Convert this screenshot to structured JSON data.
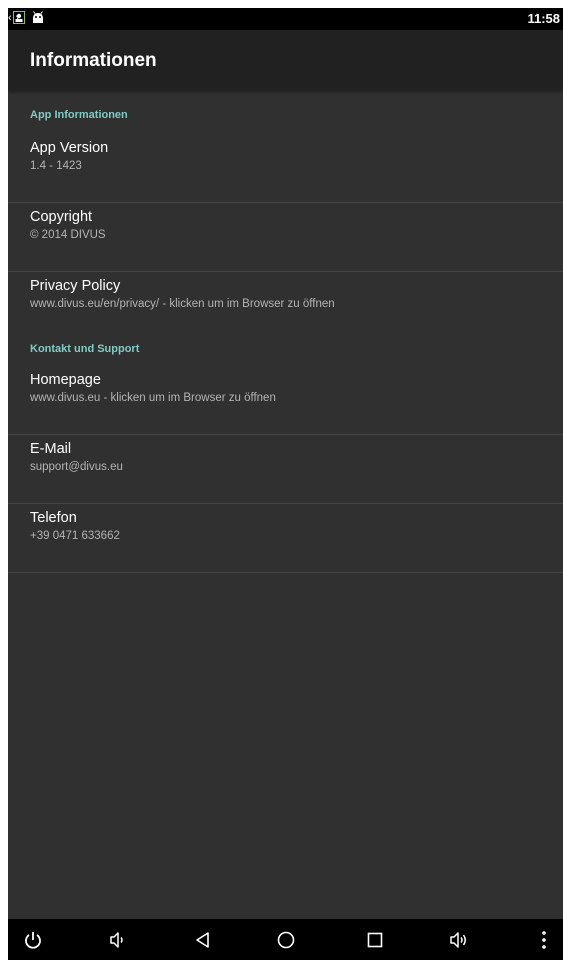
{
  "status_bar": {
    "time": "11:58",
    "left_icons": [
      "contact-notification-icon",
      "android-debug-icon"
    ],
    "right_icons": [
      "sync-arrows-icon"
    ],
    "sync_glyph": "‹·›"
  },
  "toolbar": {
    "title": "Informationen"
  },
  "sections": {
    "app": {
      "header": "App Informationen",
      "version": {
        "title": "App Version",
        "summary": "1.4 - 1423"
      },
      "copyright": {
        "title": "Copyright",
        "summary": "© 2014 DIVUS"
      },
      "privacy": {
        "title": "Privacy Policy",
        "summary": "www.divus.eu/en/privacy/ - klicken um im Browser zu öffnen"
      }
    },
    "contact": {
      "header": "Kontakt und Support",
      "homepage": {
        "title": "Homepage",
        "summary": "www.divus.eu - klicken um im Browser zu öffnen"
      },
      "email": {
        "title": "E-Mail",
        "summary": "support@divus.eu"
      },
      "phone": {
        "title": "Telefon",
        "summary": "+39 0471 633662"
      }
    }
  },
  "nav_bar": {
    "buttons": [
      "power-icon",
      "volume-down-icon",
      "back-icon",
      "home-icon",
      "recents-icon",
      "volume-up-icon",
      "overflow-menu-icon"
    ]
  },
  "colors": {
    "background": "#303030",
    "toolbar": "#212121",
    "status_bar": "#000000",
    "accent": "#80cbc4",
    "divider": "#464646",
    "title_text": "#ffffff",
    "summary_text": "#b4b4b4"
  }
}
